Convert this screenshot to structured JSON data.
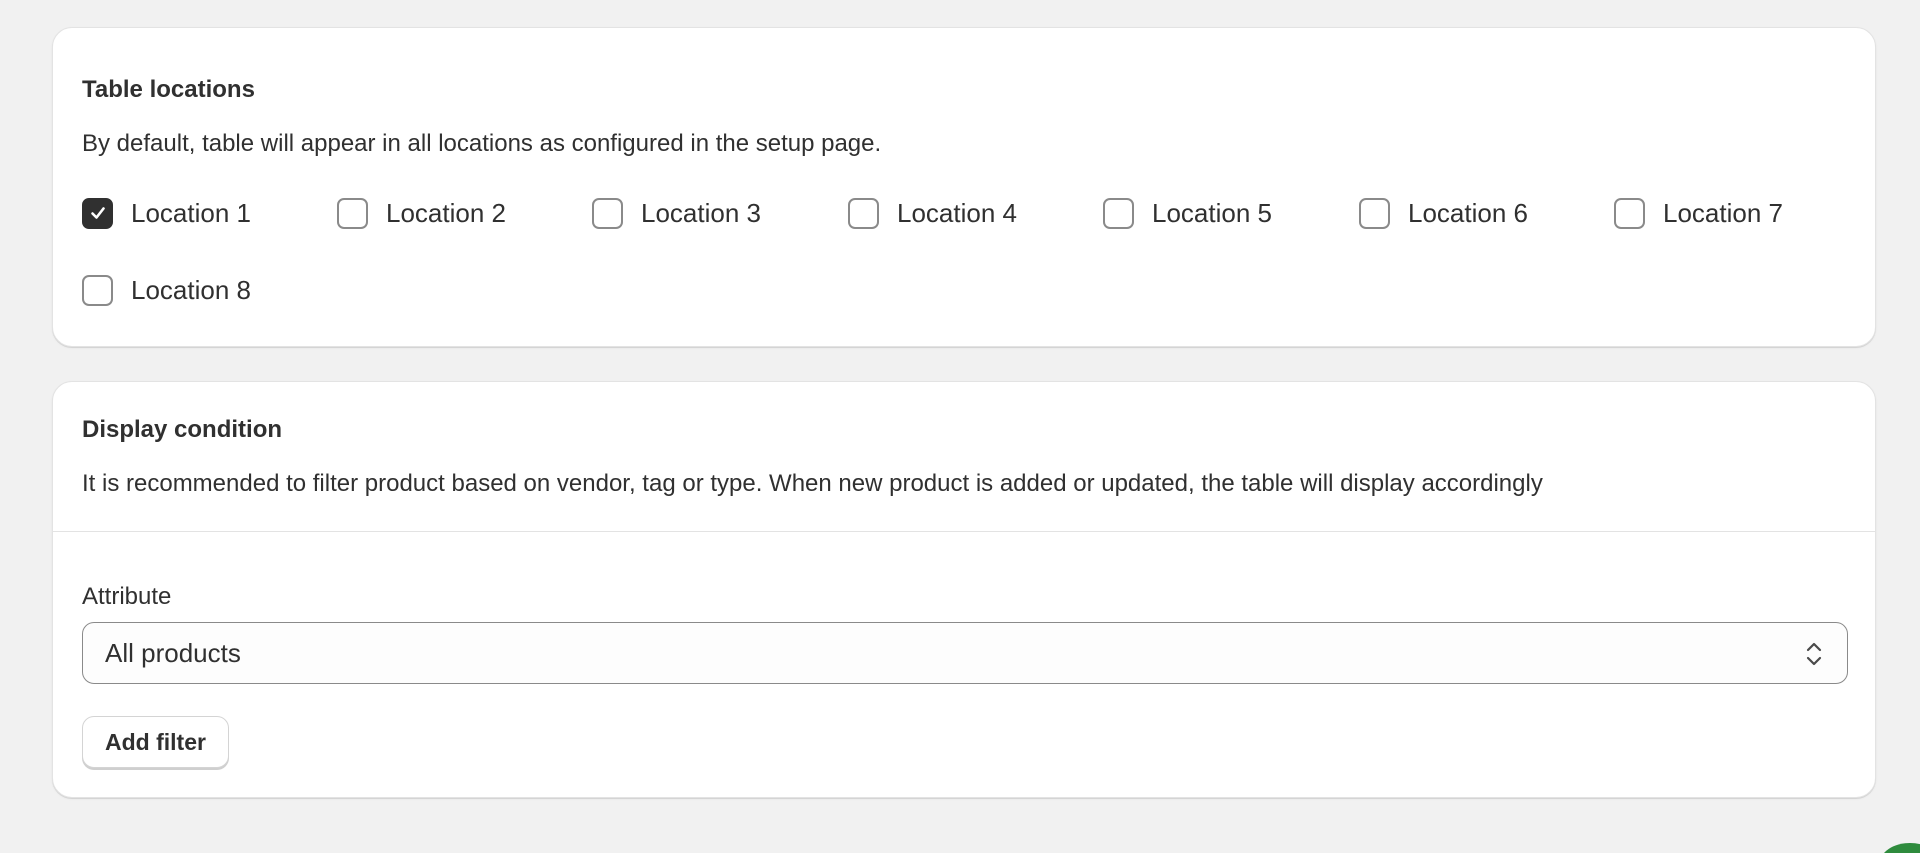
{
  "locations_card": {
    "title": "Table locations",
    "description": "By default, table will appear in all locations as configured in the setup page.",
    "locations": [
      {
        "label": "Location 1",
        "checked": true
      },
      {
        "label": "Location 2",
        "checked": false
      },
      {
        "label": "Location 3",
        "checked": false
      },
      {
        "label": "Location 4",
        "checked": false
      },
      {
        "label": "Location 5",
        "checked": false
      },
      {
        "label": "Location 6",
        "checked": false
      },
      {
        "label": "Location 7",
        "checked": false
      },
      {
        "label": "Location 8",
        "checked": false
      }
    ]
  },
  "display_card": {
    "title": "Display condition",
    "description": "It is recommended to filter product based on vendor, tag or type. When new product is added or updated, the table will display accordingly",
    "attribute_label": "Attribute",
    "attribute_value": "All products",
    "add_filter_label": "Add filter"
  },
  "colors": {
    "page_background": "#f1f1f1",
    "card_background": "#ffffff",
    "checkbox_checked": "#303030",
    "text": "#303030",
    "corner_accent": "#2e8b3d"
  },
  "icons": {
    "checkbox_checked": "checkmark-icon",
    "select_chevron": "select-chevron-icon"
  }
}
